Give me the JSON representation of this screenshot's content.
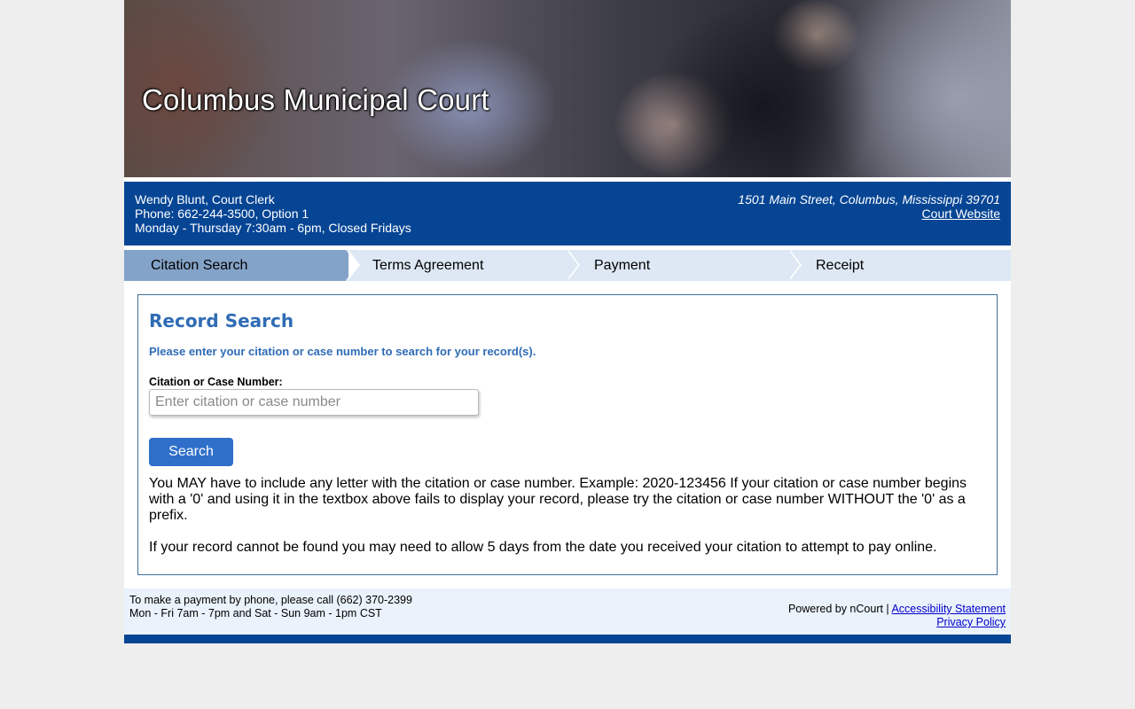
{
  "banner": {
    "title": "Columbus Municipal Court"
  },
  "info": {
    "clerk": "Wendy Blunt, Court Clerk",
    "phone": "Phone: 662-244-3500, Option 1",
    "hours": "Monday - Thursday 7:30am - 6pm, Closed Fridays",
    "address": "1501 Main Street, Columbus, Mississippi 39701",
    "website_link": "Court Website"
  },
  "steps": [
    {
      "label": "Citation Search",
      "active": true
    },
    {
      "label": "Terms Agreement",
      "active": false
    },
    {
      "label": "Payment",
      "active": false
    },
    {
      "label": "Receipt",
      "active": false
    }
  ],
  "search": {
    "heading": "Record Search",
    "hint": "Please enter your citation or case number to search for your record(s).",
    "field_label": "Citation or Case Number:",
    "placeholder": "Enter citation or case number",
    "value": "",
    "button_label": "Search",
    "note1": "You MAY have to include any letter with the citation or case number. Example: 2020-123456 If your citation or case number begins with a '0' and using it in the textbox above fails to display your record, please try the citation or case number WITHOUT the '0' as a prefix.",
    "note2": "If your record cannot be found you may need to allow 5 days from the date you received your citation to attempt to pay online."
  },
  "footer": {
    "phone_line": "To make a payment by phone, please call (662) 370-2399",
    "hours_line": "Mon - Fri 7am - 7pm and Sat - Sun 9am - 1pm CST",
    "powered_by": "Powered by nCourt | ",
    "accessibility_link": "Accessibility Statement",
    "privacy_link": "Privacy Policy"
  },
  "colors": {
    "brand_blue": "#064594",
    "step_active": "#84a3c9",
    "step_inactive": "#dde8f4",
    "accent_blue": "#2f6cb5",
    "button_blue": "#2f6fca"
  }
}
